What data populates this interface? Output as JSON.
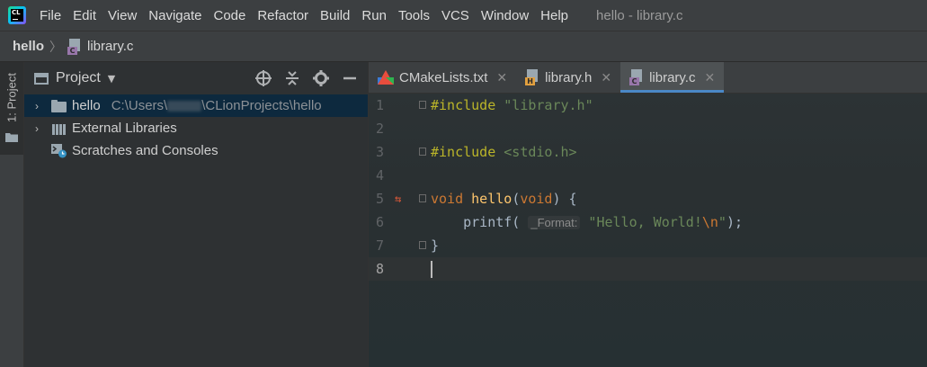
{
  "menubar": {
    "app_logo_text": "CL",
    "items": [
      "File",
      "Edit",
      "View",
      "Navigate",
      "Code",
      "Refactor",
      "Build",
      "Run",
      "Tools",
      "VCS",
      "Window",
      "Help"
    ],
    "window_title": "hello - library.c"
  },
  "breadcrumb": {
    "project": "hello",
    "file": "library.c"
  },
  "tool_stripe": {
    "project_tab_label": "1: Project"
  },
  "project_panel": {
    "title": "Project",
    "header_icons": [
      "locate-icon",
      "collapse-all-icon",
      "gear-icon",
      "minimize-icon"
    ],
    "tree": [
      {
        "label": "hello",
        "path_prefix": "C:\\Users\\",
        "path_suffix": "\\CLionProjects\\hello",
        "selected": true,
        "icon": "folder-icon",
        "expandable": true
      },
      {
        "label": "External Libraries",
        "icon": "libraries-icon",
        "expandable": true
      },
      {
        "label": "Scratches and Consoles",
        "icon": "scratches-icon",
        "expandable": false
      }
    ]
  },
  "editor": {
    "tabs": [
      {
        "label": "CMakeLists.txt",
        "icon": "cmake-icon",
        "active": false
      },
      {
        "label": "library.h",
        "icon": "h-file-icon",
        "active": false
      },
      {
        "label": "library.c",
        "icon": "c-file-icon",
        "active": true
      }
    ],
    "close_glyph": "✕",
    "line_numbers": [
      "1",
      "2",
      "3",
      "4",
      "5",
      "6",
      "7",
      "8"
    ],
    "code": {
      "l1_directive": "#include",
      "l1_string": "\"library.h\"",
      "l3_directive": "#include",
      "l3_string": "<stdio.h>",
      "l5_ret": "void",
      "l5_fn": "hello",
      "l5_param": "void",
      "l5_rest": ") {",
      "l6_call": "printf(",
      "l6_hint": "_Format:",
      "l6_str": "\"Hello, World!",
      "l6_esc": "\\n",
      "l6_str_end": "\"",
      "l6_end": ");",
      "l7_brace": "}"
    },
    "current_line": 8
  },
  "colors": {
    "keyword": "#cc7832",
    "string": "#6a8759",
    "directive": "#bbb529",
    "function": "#ffc66d",
    "tab_underline": "#4a88c7",
    "selection": "#0d293e"
  }
}
